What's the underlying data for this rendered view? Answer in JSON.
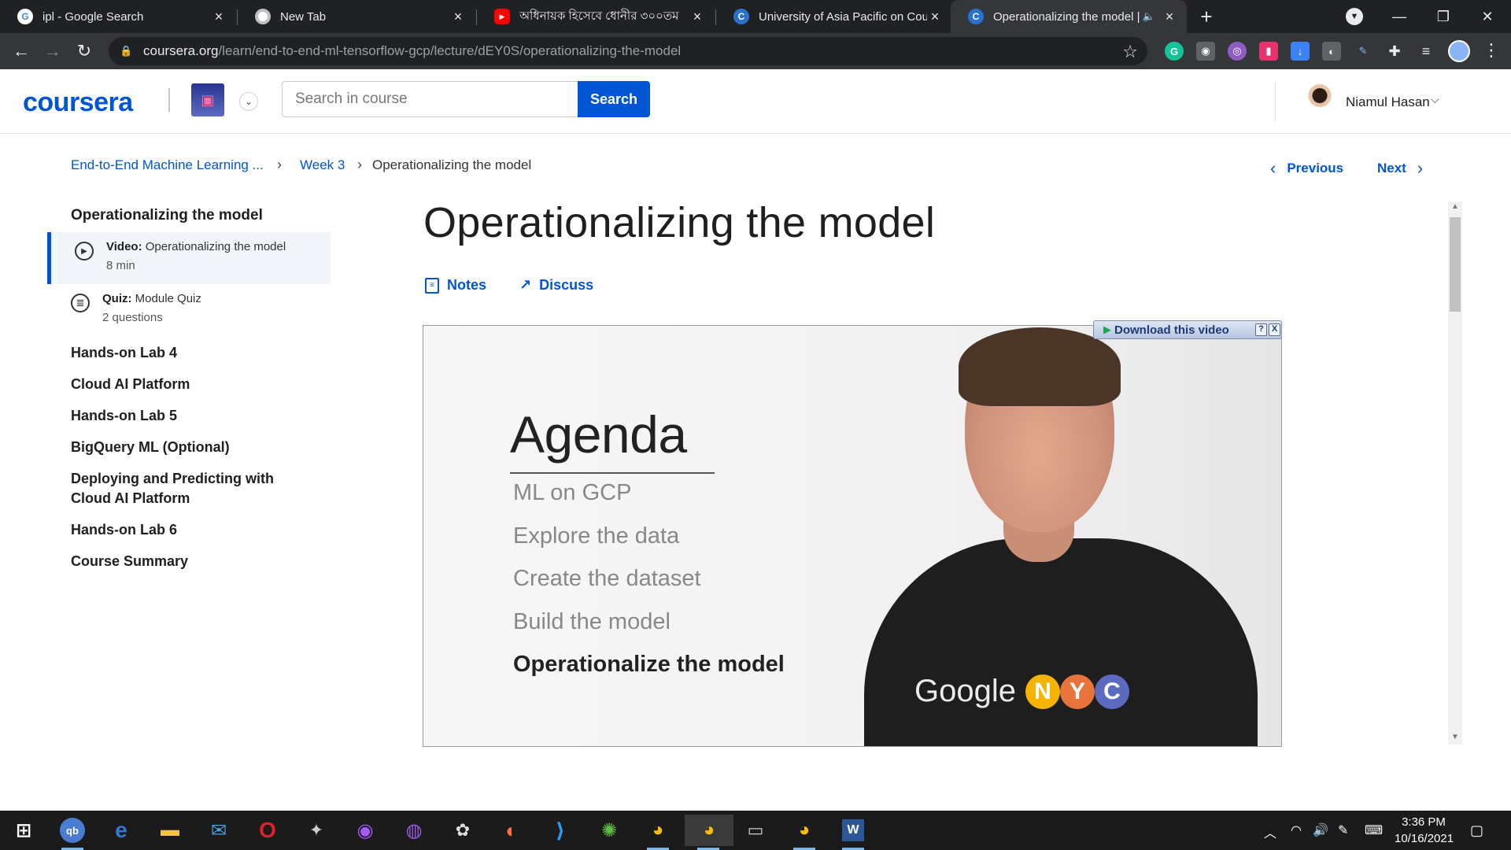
{
  "browser": {
    "tabs": [
      {
        "title": "ipl - Google Search",
        "favicon": "google-icon"
      },
      {
        "title": "New Tab",
        "favicon": "chrome-icon"
      },
      {
        "title": "অধিনায়ক হিসেবে ধোনীর ৩০০তম",
        "favicon": "youtube-icon"
      },
      {
        "title": "University of Asia Pacific on Cour",
        "favicon": "coursera-icon"
      },
      {
        "title": "Operationalizing the model |",
        "favicon": "coursera-icon"
      }
    ],
    "url_host": "coursera.org",
    "url_path": "/learn/end-to-end-ml-tensorflow-gcp/lecture/dEY0S/operationalizing-the-model"
  },
  "header": {
    "logo": "coursera",
    "search_placeholder": "Search in course",
    "search_button": "Search",
    "user_name": "Niamul Hasan"
  },
  "breadcrumb": {
    "course": "End-to-End Machine Learning ...",
    "week": "Week 3",
    "current": "Operationalizing the model"
  },
  "nav": {
    "previous": "Previous",
    "next": "Next"
  },
  "sidebar": {
    "title": "Operationalizing the model",
    "items": [
      {
        "type": "Video:",
        "label": "Operationalizing the model",
        "meta": "8 min",
        "active": true
      },
      {
        "type": "Quiz:",
        "label": "Module Quiz",
        "meta": "2 questions",
        "active": false
      }
    ],
    "sections": [
      "Hands-on Lab 4",
      "Cloud AI Platform",
      "Hands-on Lab 5",
      "BigQuery ML (Optional)",
      "Deploying and Predicting with Cloud AI Platform",
      "Hands-on Lab 6",
      "Course Summary"
    ]
  },
  "main": {
    "title": "Operationalizing the model",
    "actions": {
      "notes": "Notes",
      "discuss": "Discuss"
    }
  },
  "video": {
    "download_label": "Download this video",
    "download_help": "?",
    "download_close": "X",
    "slide_title": "Agenda",
    "agenda": [
      {
        "label": "ML on GCP",
        "current": false
      },
      {
        "label": "Explore the data",
        "current": false
      },
      {
        "label": "Create the dataset",
        "current": false
      },
      {
        "label": "Build the model",
        "current": false
      },
      {
        "label": "Operationalize the model",
        "current": true
      }
    ],
    "shirt_brand": "Google",
    "shirt_letters": [
      "N",
      "Y",
      "C"
    ]
  },
  "taskbar": {
    "time": "3:36 PM",
    "date": "10/16/2021"
  },
  "colors": {
    "accent": "#0056d2",
    "tab_strip": "#202124",
    "toolbar": "#35363a",
    "taskbar": "#1b1b1b"
  }
}
